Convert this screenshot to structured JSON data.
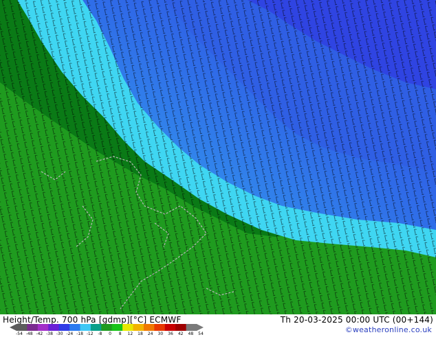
{
  "footer": {
    "title": "Height/Temp. 700 hPa [gdmp][°C] ECMWF",
    "valid_time": "Th 20-03-2025 00:00 UTC (00+144)",
    "copyright": "©weatheronline.co.uk"
  },
  "colorbar": {
    "labels": [
      "-54",
      "-48",
      "-42",
      "-38",
      "-30",
      "-24",
      "-18",
      "-12",
      "-8",
      "0",
      "8",
      "12",
      "18",
      "24",
      "30",
      "36",
      "42",
      "48",
      "54"
    ],
    "colors": [
      "#5c5c5c",
      "#7a2a8f",
      "#a22ec8",
      "#6a1fd6",
      "#2f3be6",
      "#2a7af0",
      "#3fc8f5",
      "#0aa08a",
      "#1f9b1f",
      "#18c418",
      "#e8e800",
      "#f2b300",
      "#f07800",
      "#e83800",
      "#c80000",
      "#9e0000",
      "#7a7a7a"
    ]
  },
  "map": {
    "colors": {
      "dark_green": "#0a7a16",
      "green": "#1f9b1f",
      "cyan": "#3fd6f2",
      "light_blue": "#35a8f0",
      "blue": "#2f6ee8",
      "deep_blue": "#2f44e2",
      "coastline": "#b8b8b8"
    }
  }
}
